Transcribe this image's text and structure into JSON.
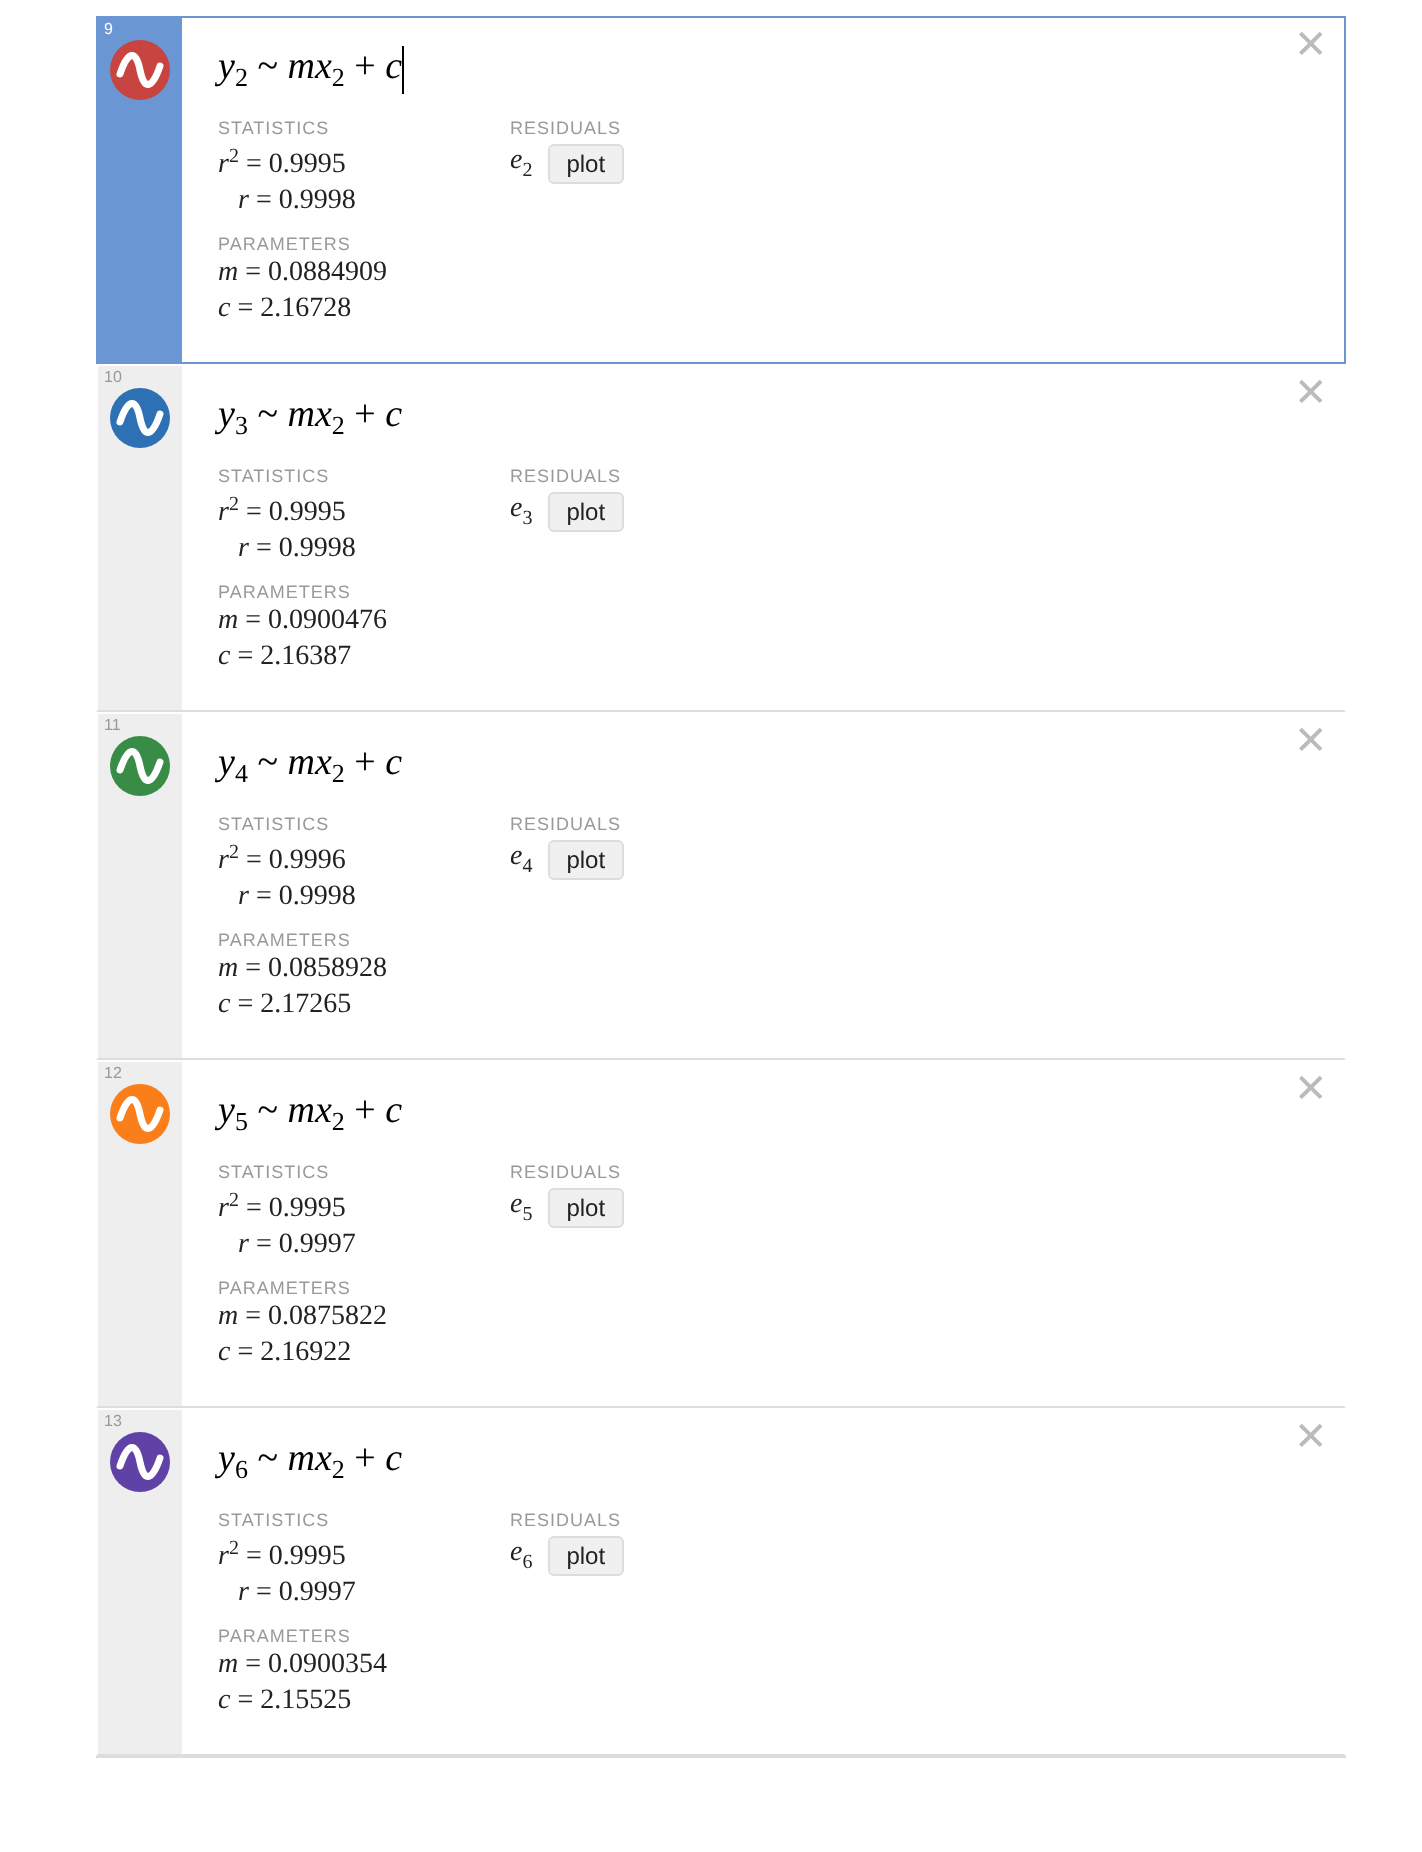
{
  "expressions": [
    {
      "number": "9",
      "color": "#c74440",
      "selected": true,
      "formula": "*y*$_{2}$ ~ *mx*$_{2}$ + *c*",
      "statistics_label": "STATISTICS",
      "statistics": [
        "*r*$^{2}$ = 0.9995",
        "*r* = 0.9998"
      ],
      "residuals_label": "RESIDUALS",
      "residual": "*e*$_{2}$",
      "plot_button": "plot",
      "parameters_label": "PARAMETERS",
      "parameters": [
        "*m* = 0.0884909",
        "*c* = 2.16728"
      ],
      "close": "✕"
    },
    {
      "number": "10",
      "color": "#2d70b3",
      "selected": false,
      "formula": "*y*$_{3}$ ~ *mx*$_{2}$ + *c*",
      "statistics_label": "STATISTICS",
      "statistics": [
        "*r*$^{2}$ = 0.9995",
        "*r* = 0.9998"
      ],
      "residuals_label": "RESIDUALS",
      "residual": "*e*$_{3}$",
      "plot_button": "plot",
      "parameters_label": "PARAMETERS",
      "parameters": [
        "*m* = 0.0900476",
        "*c* = 2.16387"
      ],
      "close": "✕"
    },
    {
      "number": "11",
      "color": "#388c46",
      "selected": false,
      "formula": "*y*$_{4}$ ~ *mx*$_{2}$ + *c*",
      "statistics_label": "STATISTICS",
      "statistics": [
        "*r*$^{2}$ = 0.9996",
        "*r* = 0.9998"
      ],
      "residuals_label": "RESIDUALS",
      "residual": "*e*$_{4}$",
      "plot_button": "plot",
      "parameters_label": "PARAMETERS",
      "parameters": [
        "*m* = 0.0858928",
        "*c* = 2.17265"
      ],
      "close": "✕"
    },
    {
      "number": "12",
      "color": "#fa7e19",
      "selected": false,
      "formula": "*y*$_{5}$ ~ *mx*$_{2}$ + *c*",
      "statistics_label": "STATISTICS",
      "statistics": [
        "*r*$^{2}$ = 0.9995",
        "*r* = 0.9997"
      ],
      "residuals_label": "RESIDUALS",
      "residual": "*e*$_{5}$",
      "plot_button": "plot",
      "parameters_label": "PARAMETERS",
      "parameters": [
        "*m* = 0.0875822",
        "*c* = 2.16922"
      ],
      "close": "✕"
    },
    {
      "number": "13",
      "color": "#6042a6",
      "selected": false,
      "formula": "*y*$_{6}$ ~ *mx*$_{2}$ + *c*",
      "statistics_label": "STATISTICS",
      "statistics": [
        "*r*$^{2}$ = 0.9995",
        "*r* = 0.9997"
      ],
      "residuals_label": "RESIDUALS",
      "residual": "*e*$_{6}$",
      "plot_button": "plot",
      "parameters_label": "PARAMETERS",
      "parameters": [
        "*m* = 0.0900354",
        "*c* = 2.15525"
      ],
      "close": "✕"
    }
  ]
}
